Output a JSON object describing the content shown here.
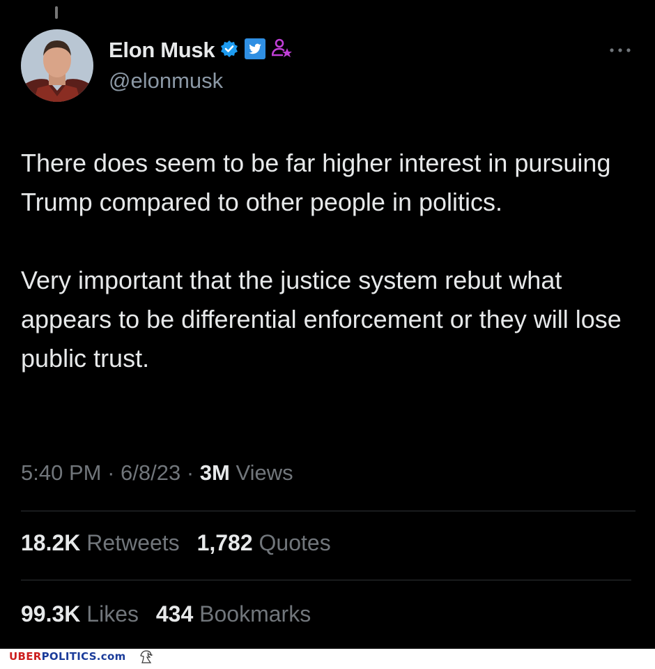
{
  "tweet": {
    "author_name": "Elon Musk",
    "handle": "@elonmusk",
    "paragraphs": [
      "There does seem to be far higher interest in pursuing Trump compared to other people in politics.",
      "Very important that the justice system rebut what appears to be differential enforcement or they will lose public trust."
    ],
    "time": "5:40 PM",
    "date": "6/8/23",
    "views_count": "3M",
    "views_label": "Views",
    "retweets_count": "18.2K",
    "retweets_label": "Retweets",
    "quotes_count": "1,782",
    "quotes_label": "Quotes",
    "likes_count": "99.3K",
    "likes_label": "Likes",
    "bookmarks_count": "434",
    "bookmarks_label": "Bookmarks",
    "icons": [
      "verified-badge-icon",
      "twitter-affiliate-icon",
      "person-star-icon",
      "more-options-icon"
    ]
  },
  "footer": {
    "site_part1": "UBER",
    "site_part2": "POLITICS.com",
    "icons": [
      "eagle-icon"
    ]
  },
  "colors": {
    "background": "#000000",
    "text_primary": "#e7e9ea",
    "text_secondary": "#71767b",
    "verified_blue": "#1d9bf0",
    "affiliate_purple": "#c03fd6",
    "brand_red": "#cc1f1f",
    "brand_blue": "#1b3c9a"
  }
}
